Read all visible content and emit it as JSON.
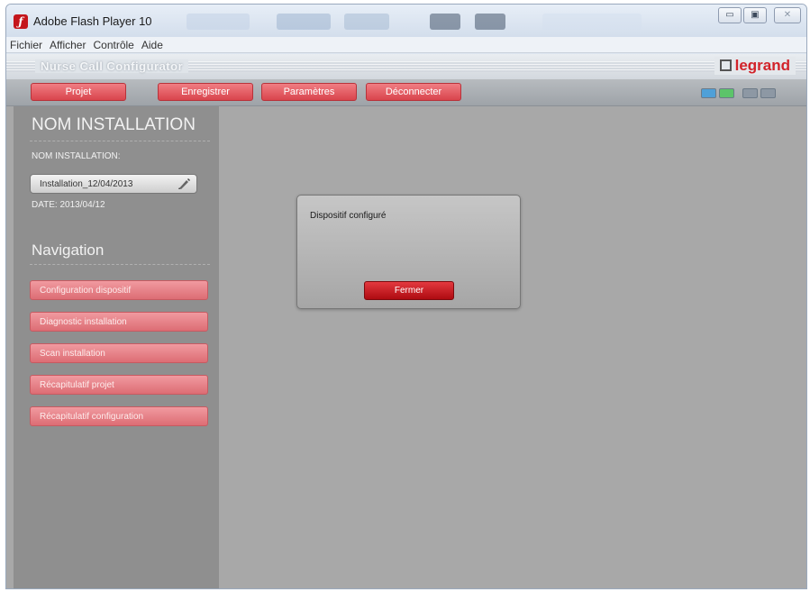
{
  "window": {
    "title": "Adobe Flash Player 10",
    "controls": [
      "minimize",
      "maximize",
      "close"
    ]
  },
  "menubar": {
    "items": [
      "Fichier",
      "Afficher",
      "Contrôle",
      "Aide"
    ]
  },
  "app": {
    "name": "Nurse Call Configurator",
    "brand": "legrand",
    "toolbar": [
      "Projet",
      "Enregistrer",
      "Paramètres",
      "Déconnecter"
    ]
  },
  "sidebar": {
    "heading": "NOM INSTALLATION",
    "name_label": "NOM INSTALLATION:",
    "name_value": "Installation_12/04/2013",
    "date": "DATE: 2013/04/12",
    "nav_heading": "Navigation",
    "nav_items": [
      "Configuration dispositif",
      "Diagnostic installation",
      "Scan installation",
      "Récapitulatif projet",
      "Récapitulatif configuration"
    ]
  },
  "dialog": {
    "message": "Dispositif configuré",
    "button": "Fermer"
  },
  "colors": {
    "accent_red": "#d9444c",
    "dialog_button": "#ae0b11",
    "content_bg": "#a8a8a8",
    "sidebar_bg": "#8f8f8f"
  }
}
